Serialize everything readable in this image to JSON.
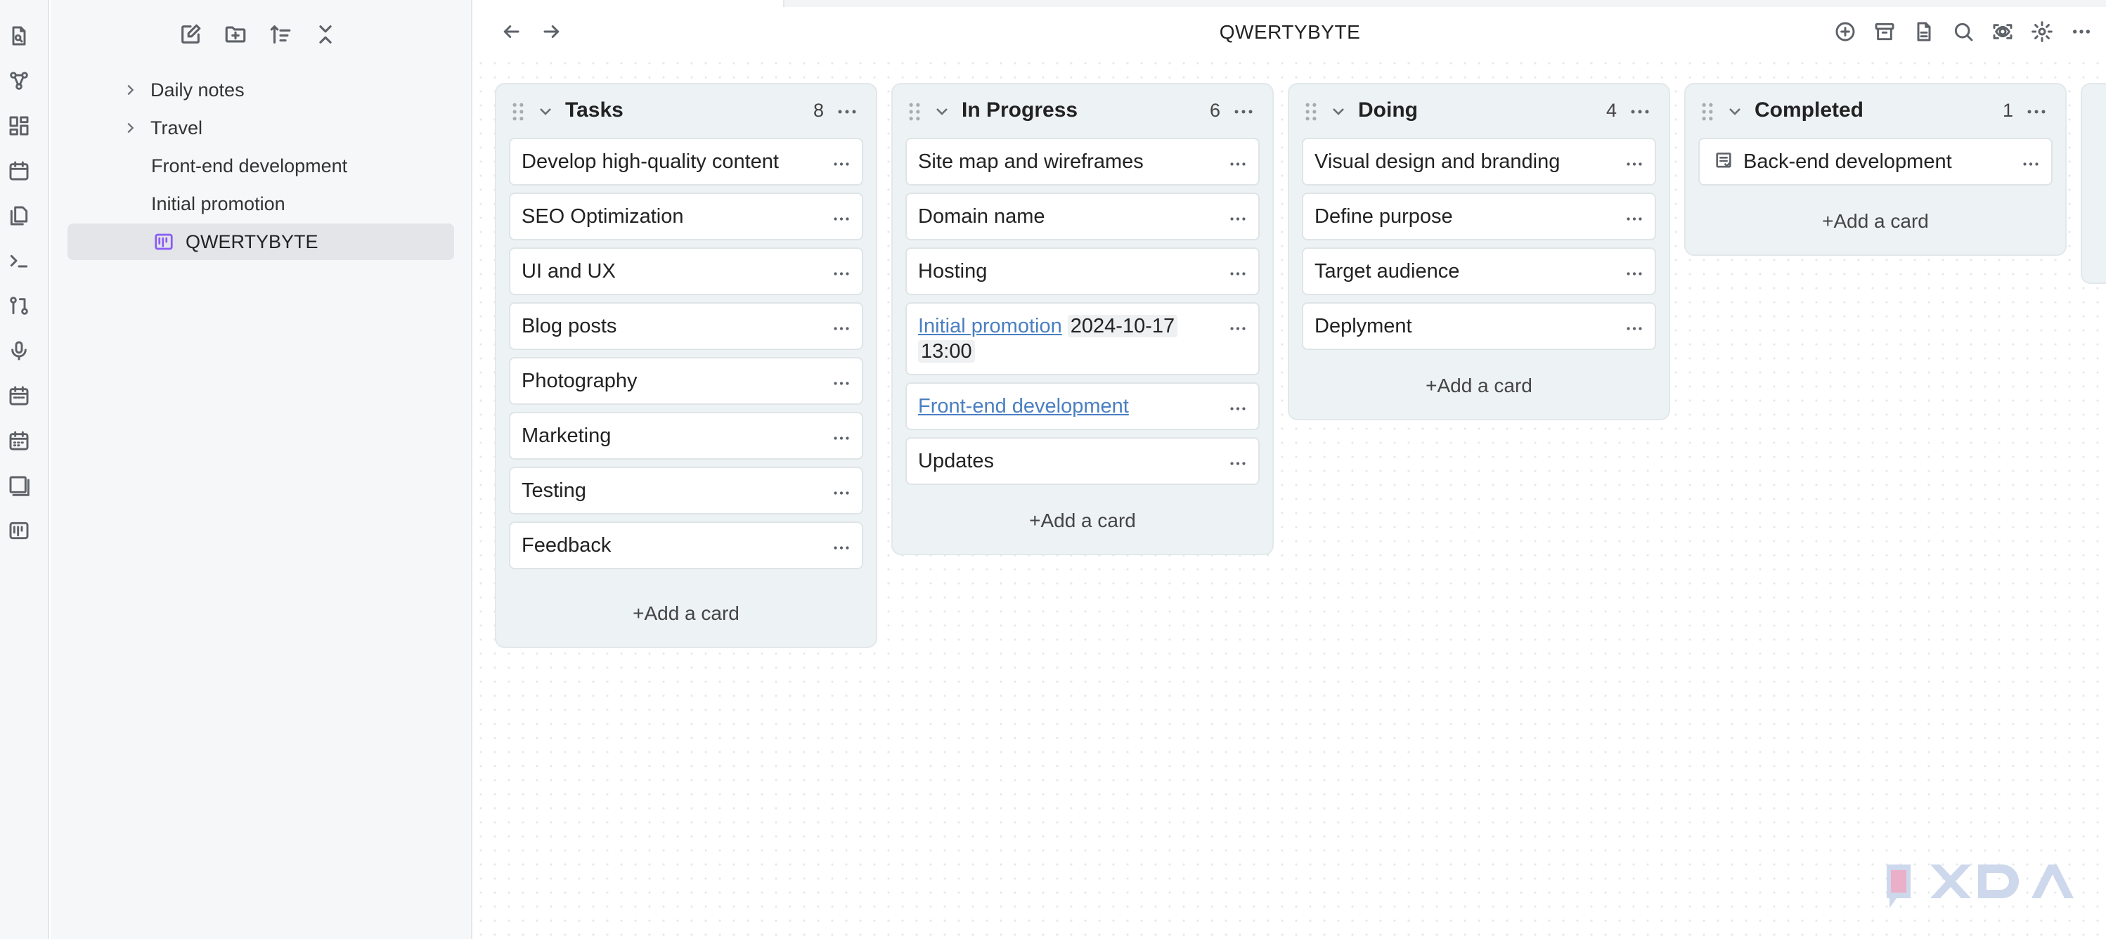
{
  "app": {
    "title": "QWERTYBYTE"
  },
  "ribbon": {
    "icons": [
      "open-note-icon",
      "graph-view-icon",
      "canvas-icon",
      "daily-note-icon",
      "files-icon",
      "command-palette-icon",
      "diff-icon",
      "microphone-icon",
      "calendar-icon",
      "calendar-grid-icon",
      "gallery-icon",
      "kanban-icon"
    ]
  },
  "sidebar": {
    "actions": [
      "new-note-icon",
      "new-folder-icon",
      "sort-icon",
      "collapse-all-icon"
    ],
    "items": [
      {
        "label": "Daily notes",
        "kind": "folder"
      },
      {
        "label": "Travel",
        "kind": "folder"
      },
      {
        "label": "Front-end development",
        "kind": "file"
      },
      {
        "label": "Initial promotion",
        "kind": "file"
      },
      {
        "label": "QWERTYBYTE",
        "kind": "kanban",
        "active": true
      }
    ]
  },
  "header": {
    "actions": [
      "add-icon",
      "archive-icon",
      "document-icon",
      "search-icon",
      "view-icon",
      "settings-icon",
      "more-icon"
    ]
  },
  "board": {
    "add_label": "+Add a card",
    "lanes": [
      {
        "name": "Tasks",
        "count": "8",
        "cards": [
          {
            "text": "Develop high-quality content"
          },
          {
            "text": "SEO Optimization"
          },
          {
            "text": "UI and UX"
          },
          {
            "text": "Blog posts"
          },
          {
            "text": "Photography"
          },
          {
            "text": "Marketing"
          },
          {
            "text": "Testing"
          },
          {
            "text": "Feedback"
          }
        ]
      },
      {
        "name": "In Progress",
        "count": "6",
        "cards": [
          {
            "text": "Site map and wireframes"
          },
          {
            "text": "Domain name"
          },
          {
            "text": "Hosting"
          },
          {
            "link": "Initial promotion",
            "date": "2024-10-17",
            "time": "13:00"
          },
          {
            "link": "Front-end development"
          },
          {
            "text": "Updates"
          }
        ]
      },
      {
        "name": "Doing",
        "count": "4",
        "cards": [
          {
            "text": "Visual design and branding"
          },
          {
            "text": "Define purpose"
          },
          {
            "text": "Target audience"
          },
          {
            "text": "Deplyment"
          }
        ]
      },
      {
        "name": "Completed",
        "count": "1",
        "cards": [
          {
            "text": "Back-end development",
            "icon": "task-icon"
          }
        ]
      }
    ]
  },
  "watermark": {
    "brand": "XDA"
  },
  "colors": {
    "accent": "#8a5cf5",
    "link": "#4a7fc1",
    "lane_bg": "#edf2f4",
    "sidebar_bg": "#f6f7f8"
  }
}
